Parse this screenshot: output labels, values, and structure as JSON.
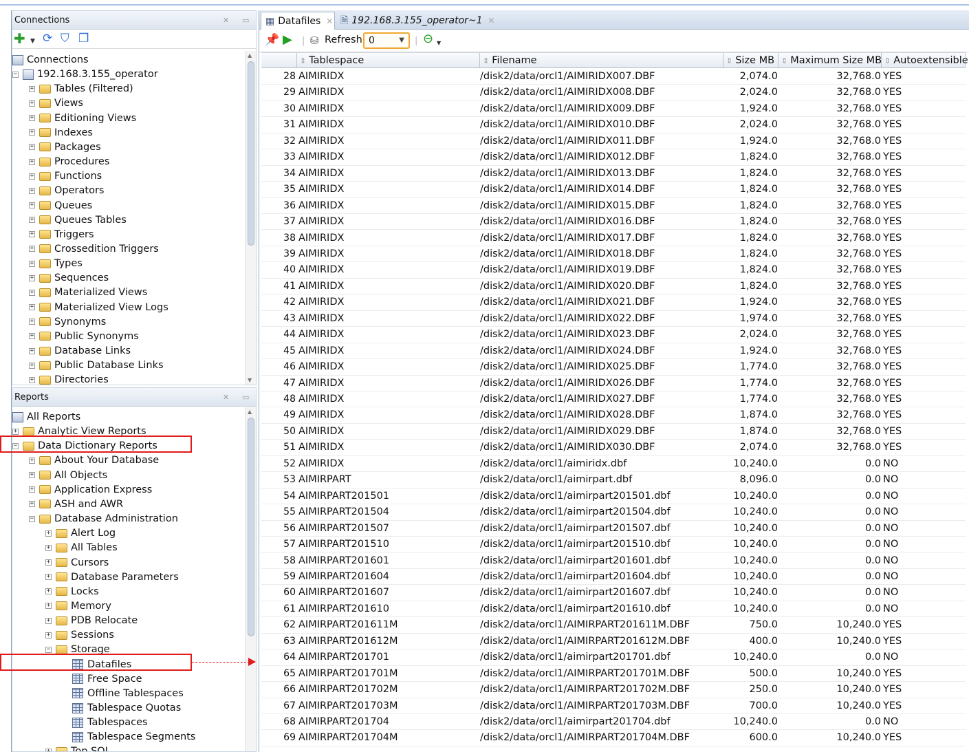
{
  "connections_panel": {
    "title": "Connections",
    "tree": [
      {
        "label": "Connections",
        "level": 0,
        "toggle": "",
        "icon": "connections-icon"
      },
      {
        "label": "192.168.3.155_operator",
        "level": 0,
        "toggle": "−",
        "icon": "database-connection-icon"
      },
      {
        "label": "Tables (Filtered)",
        "level": 1,
        "toggle": "+",
        "icon": "tables-folder-icon"
      },
      {
        "label": "Views",
        "level": 1,
        "toggle": "+",
        "icon": "views-folder-icon"
      },
      {
        "label": "Editioning Views",
        "level": 1,
        "toggle": "+",
        "icon": "editioning-views-folder-icon"
      },
      {
        "label": "Indexes",
        "level": 1,
        "toggle": "+",
        "icon": "indexes-folder-icon"
      },
      {
        "label": "Packages",
        "level": 1,
        "toggle": "+",
        "icon": "packages-folder-icon"
      },
      {
        "label": "Procedures",
        "level": 1,
        "toggle": "+",
        "icon": "procedures-folder-icon"
      },
      {
        "label": "Functions",
        "level": 1,
        "toggle": "+",
        "icon": "functions-folder-icon"
      },
      {
        "label": "Operators",
        "level": 1,
        "toggle": "+",
        "icon": "operators-folder-icon"
      },
      {
        "label": "Queues",
        "level": 1,
        "toggle": "+",
        "icon": "queues-folder-icon"
      },
      {
        "label": "Queues Tables",
        "level": 1,
        "toggle": "+",
        "icon": "queues-tables-folder-icon"
      },
      {
        "label": "Triggers",
        "level": 1,
        "toggle": "+",
        "icon": "triggers-folder-icon"
      },
      {
        "label": "Crossedition Triggers",
        "level": 1,
        "toggle": "+",
        "icon": "crossedition-triggers-folder-icon"
      },
      {
        "label": "Types",
        "level": 1,
        "toggle": "+",
        "icon": "types-folder-icon"
      },
      {
        "label": "Sequences",
        "level": 1,
        "toggle": "+",
        "icon": "sequences-folder-icon"
      },
      {
        "label": "Materialized Views",
        "level": 1,
        "toggle": "+",
        "icon": "materialized-views-folder-icon"
      },
      {
        "label": "Materialized View Logs",
        "level": 1,
        "toggle": "+",
        "icon": "materialized-view-logs-folder-icon"
      },
      {
        "label": "Synonyms",
        "level": 1,
        "toggle": "+",
        "icon": "synonyms-folder-icon"
      },
      {
        "label": "Public Synonyms",
        "level": 1,
        "toggle": "+",
        "icon": "public-synonyms-folder-icon"
      },
      {
        "label": "Database Links",
        "level": 1,
        "toggle": "+",
        "icon": "database-links-folder-icon"
      },
      {
        "label": "Public Database Links",
        "level": 1,
        "toggle": "+",
        "icon": "public-database-links-folder-icon"
      },
      {
        "label": "Directories",
        "level": 1,
        "toggle": "+",
        "icon": "directories-folder-icon"
      }
    ]
  },
  "reports_panel": {
    "title": "Reports",
    "tree": [
      {
        "label": "All Reports",
        "level": 0,
        "toggle": "",
        "icon": "reports-icon"
      },
      {
        "label": "Analytic View Reports",
        "level": 0,
        "toggle": "+",
        "icon": "folder-icon"
      },
      {
        "label": "Data Dictionary Reports",
        "level": 0,
        "toggle": "−",
        "icon": "folder-open-icon"
      },
      {
        "label": "About Your Database",
        "level": 1,
        "toggle": "+",
        "icon": "folder-icon"
      },
      {
        "label": "All Objects",
        "level": 1,
        "toggle": "+",
        "icon": "folder-icon"
      },
      {
        "label": "Application Express",
        "level": 1,
        "toggle": "+",
        "icon": "folder-icon"
      },
      {
        "label": "ASH and AWR",
        "level": 1,
        "toggle": "+",
        "icon": "folder-icon"
      },
      {
        "label": "Database Administration",
        "level": 1,
        "toggle": "−",
        "icon": "folder-open-icon"
      },
      {
        "label": "Alert Log",
        "level": 2,
        "toggle": "+",
        "icon": "folder-icon"
      },
      {
        "label": "All Tables",
        "level": 2,
        "toggle": "+",
        "icon": "folder-icon"
      },
      {
        "label": "Cursors",
        "level": 2,
        "toggle": "+",
        "icon": "folder-icon"
      },
      {
        "label": "Database Parameters",
        "level": 2,
        "toggle": "+",
        "icon": "folder-icon"
      },
      {
        "label": "Locks",
        "level": 2,
        "toggle": "+",
        "icon": "folder-icon"
      },
      {
        "label": "Memory",
        "level": 2,
        "toggle": "+",
        "icon": "folder-icon"
      },
      {
        "label": "PDB Relocate",
        "level": 2,
        "toggle": "+",
        "icon": "folder-icon"
      },
      {
        "label": "Sessions",
        "level": 2,
        "toggle": "+",
        "icon": "folder-icon"
      },
      {
        "label": "Storage",
        "level": 2,
        "toggle": "−",
        "icon": "folder-open-icon"
      },
      {
        "label": "Datafiles",
        "level": 3,
        "toggle": "",
        "icon": "report-grid-icon"
      },
      {
        "label": "Free Space",
        "level": 3,
        "toggle": "",
        "icon": "report-grid-icon"
      },
      {
        "label": "Offline Tablespaces",
        "level": 3,
        "toggle": "",
        "icon": "report-grid-icon"
      },
      {
        "label": "Tablespace Quotas",
        "level": 3,
        "toggle": "",
        "icon": "report-grid-icon"
      },
      {
        "label": "Tablespaces",
        "level": 3,
        "toggle": "",
        "icon": "report-grid-icon"
      },
      {
        "label": "Tablespace Segments",
        "level": 3,
        "toggle": "",
        "icon": "report-grid-icon"
      },
      {
        "label": "Top SQL",
        "level": 2,
        "toggle": "+",
        "icon": "folder-icon"
      }
    ]
  },
  "editor": {
    "tabs": [
      {
        "label": "Datafiles",
        "active": true
      },
      {
        "label": "192.168.3.155_operator~1",
        "active": false
      }
    ],
    "toolbar": {
      "refresh_label": "Refresh:",
      "refresh_value": "0"
    },
    "columns": [
      "Tablespace",
      "Filename",
      "Size MB",
      "Maximum Size MB",
      "Autoextensible"
    ],
    "rows": [
      [
        "28",
        "AIMIRIDX",
        "/disk2/data/orcl1/AIMIRIDX007.DBF",
        "2,074.0",
        "32,768.0",
        "YES"
      ],
      [
        "29",
        "AIMIRIDX",
        "/disk2/data/orcl1/AIMIRIDX008.DBF",
        "2,024.0",
        "32,768.0",
        "YES"
      ],
      [
        "30",
        "AIMIRIDX",
        "/disk2/data/orcl1/AIMIRIDX009.DBF",
        "1,924.0",
        "32,768.0",
        "YES"
      ],
      [
        "31",
        "AIMIRIDX",
        "/disk2/data/orcl1/AIMIRIDX010.DBF",
        "2,024.0",
        "32,768.0",
        "YES"
      ],
      [
        "32",
        "AIMIRIDX",
        "/disk2/data/orcl1/AIMIRIDX011.DBF",
        "1,924.0",
        "32,768.0",
        "YES"
      ],
      [
        "33",
        "AIMIRIDX",
        "/disk2/data/orcl1/AIMIRIDX012.DBF",
        "1,824.0",
        "32,768.0",
        "YES"
      ],
      [
        "34",
        "AIMIRIDX",
        "/disk2/data/orcl1/AIMIRIDX013.DBF",
        "1,824.0",
        "32,768.0",
        "YES"
      ],
      [
        "35",
        "AIMIRIDX",
        "/disk2/data/orcl1/AIMIRIDX014.DBF",
        "1,824.0",
        "32,768.0",
        "YES"
      ],
      [
        "36",
        "AIMIRIDX",
        "/disk2/data/orcl1/AIMIRIDX015.DBF",
        "1,824.0",
        "32,768.0",
        "YES"
      ],
      [
        "37",
        "AIMIRIDX",
        "/disk2/data/orcl1/AIMIRIDX016.DBF",
        "1,824.0",
        "32,768.0",
        "YES"
      ],
      [
        "38",
        "AIMIRIDX",
        "/disk2/data/orcl1/AIMIRIDX017.DBF",
        "1,824.0",
        "32,768.0",
        "YES"
      ],
      [
        "39",
        "AIMIRIDX",
        "/disk2/data/orcl1/AIMIRIDX018.DBF",
        "1,824.0",
        "32,768.0",
        "YES"
      ],
      [
        "40",
        "AIMIRIDX",
        "/disk2/data/orcl1/AIMIRIDX019.DBF",
        "1,824.0",
        "32,768.0",
        "YES"
      ],
      [
        "41",
        "AIMIRIDX",
        "/disk2/data/orcl1/AIMIRIDX020.DBF",
        "1,824.0",
        "32,768.0",
        "YES"
      ],
      [
        "42",
        "AIMIRIDX",
        "/disk2/data/orcl1/AIMIRIDX021.DBF",
        "1,924.0",
        "32,768.0",
        "YES"
      ],
      [
        "43",
        "AIMIRIDX",
        "/disk2/data/orcl1/AIMIRIDX022.DBF",
        "1,974.0",
        "32,768.0",
        "YES"
      ],
      [
        "44",
        "AIMIRIDX",
        "/disk2/data/orcl1/AIMIRIDX023.DBF",
        "2,024.0",
        "32,768.0",
        "YES"
      ],
      [
        "45",
        "AIMIRIDX",
        "/disk2/data/orcl1/AIMIRIDX024.DBF",
        "1,924.0",
        "32,768.0",
        "YES"
      ],
      [
        "46",
        "AIMIRIDX",
        "/disk2/data/orcl1/AIMIRIDX025.DBF",
        "1,774.0",
        "32,768.0",
        "YES"
      ],
      [
        "47",
        "AIMIRIDX",
        "/disk2/data/orcl1/AIMIRIDX026.DBF",
        "1,774.0",
        "32,768.0",
        "YES"
      ],
      [
        "48",
        "AIMIRIDX",
        "/disk2/data/orcl1/AIMIRIDX027.DBF",
        "1,774.0",
        "32,768.0",
        "YES"
      ],
      [
        "49",
        "AIMIRIDX",
        "/disk2/data/orcl1/AIMIRIDX028.DBF",
        "1,874.0",
        "32,768.0",
        "YES"
      ],
      [
        "50",
        "AIMIRIDX",
        "/disk2/data/orcl1/AIMIRIDX029.DBF",
        "1,874.0",
        "32,768.0",
        "YES"
      ],
      [
        "51",
        "AIMIRIDX",
        "/disk2/data/orcl1/AIMIRIDX030.DBF",
        "2,074.0",
        "32,768.0",
        "YES"
      ],
      [
        "52",
        "AIMIRIDX",
        "/disk2/data/orcl1/aimiridx.dbf",
        "10,240.0",
        "0.0",
        "NO"
      ],
      [
        "53",
        "AIMIRPART",
        "/disk2/data/orcl1/aimirpart.dbf",
        "8,096.0",
        "0.0",
        "NO"
      ],
      [
        "54",
        "AIMIRPART201501",
        "/disk2/data/orcl1/aimirpart201501.dbf",
        "10,240.0",
        "0.0",
        "NO"
      ],
      [
        "55",
        "AIMIRPART201504",
        "/disk2/data/orcl1/aimirpart201504.dbf",
        "10,240.0",
        "0.0",
        "NO"
      ],
      [
        "56",
        "AIMIRPART201507",
        "/disk2/data/orcl1/aimirpart201507.dbf",
        "10,240.0",
        "0.0",
        "NO"
      ],
      [
        "57",
        "AIMIRPART201510",
        "/disk2/data/orcl1/aimirpart201510.dbf",
        "10,240.0",
        "0.0",
        "NO"
      ],
      [
        "58",
        "AIMIRPART201601",
        "/disk2/data/orcl1/aimirpart201601.dbf",
        "10,240.0",
        "0.0",
        "NO"
      ],
      [
        "59",
        "AIMIRPART201604",
        "/disk2/data/orcl1/aimirpart201604.dbf",
        "10,240.0",
        "0.0",
        "NO"
      ],
      [
        "60",
        "AIMIRPART201607",
        "/disk2/data/orcl1/aimirpart201607.dbf",
        "10,240.0",
        "0.0",
        "NO"
      ],
      [
        "61",
        "AIMIRPART201610",
        "/disk2/data/orcl1/aimirpart201610.dbf",
        "10,240.0",
        "0.0",
        "NO"
      ],
      [
        "62",
        "AIMIRPART201611M",
        "/disk2/data/orcl1/AIMIRPART201611M.DBF",
        "750.0",
        "10,240.0",
        "YES"
      ],
      [
        "63",
        "AIMIRPART201612M",
        "/disk2/data/orcl1/AIMIRPART201612M.DBF",
        "400.0",
        "10,240.0",
        "YES"
      ],
      [
        "64",
        "AIMIRPART201701",
        "/disk2/data/orcl1/aimirpart201701.dbf",
        "10,240.0",
        "0.0",
        "NO"
      ],
      [
        "65",
        "AIMIRPART201701M",
        "/disk2/data/orcl1/AIMIRPART201701M.DBF",
        "500.0",
        "10,240.0",
        "YES"
      ],
      [
        "66",
        "AIMIRPART201702M",
        "/disk2/data/orcl1/AIMIRPART201702M.DBF",
        "250.0",
        "10,240.0",
        "YES"
      ],
      [
        "67",
        "AIMIRPART201703M",
        "/disk2/data/orcl1/AIMIRPART201703M.DBF",
        "700.0",
        "10,240.0",
        "YES"
      ],
      [
        "68",
        "AIMIRPART201704",
        "/disk2/data/orcl1/aimirpart201704.dbf",
        "10,240.0",
        "0.0",
        "NO"
      ],
      [
        "69",
        "AIMIRPART201704M",
        "/disk2/data/orcl1/AIMIRPART201704M.DBF",
        "600.0",
        "10,240.0",
        "YES"
      ]
    ]
  },
  "colors": {
    "highlight": "#e01b1b",
    "panel_header": "#dde5ef",
    "refresh_border": "#f0a830"
  }
}
